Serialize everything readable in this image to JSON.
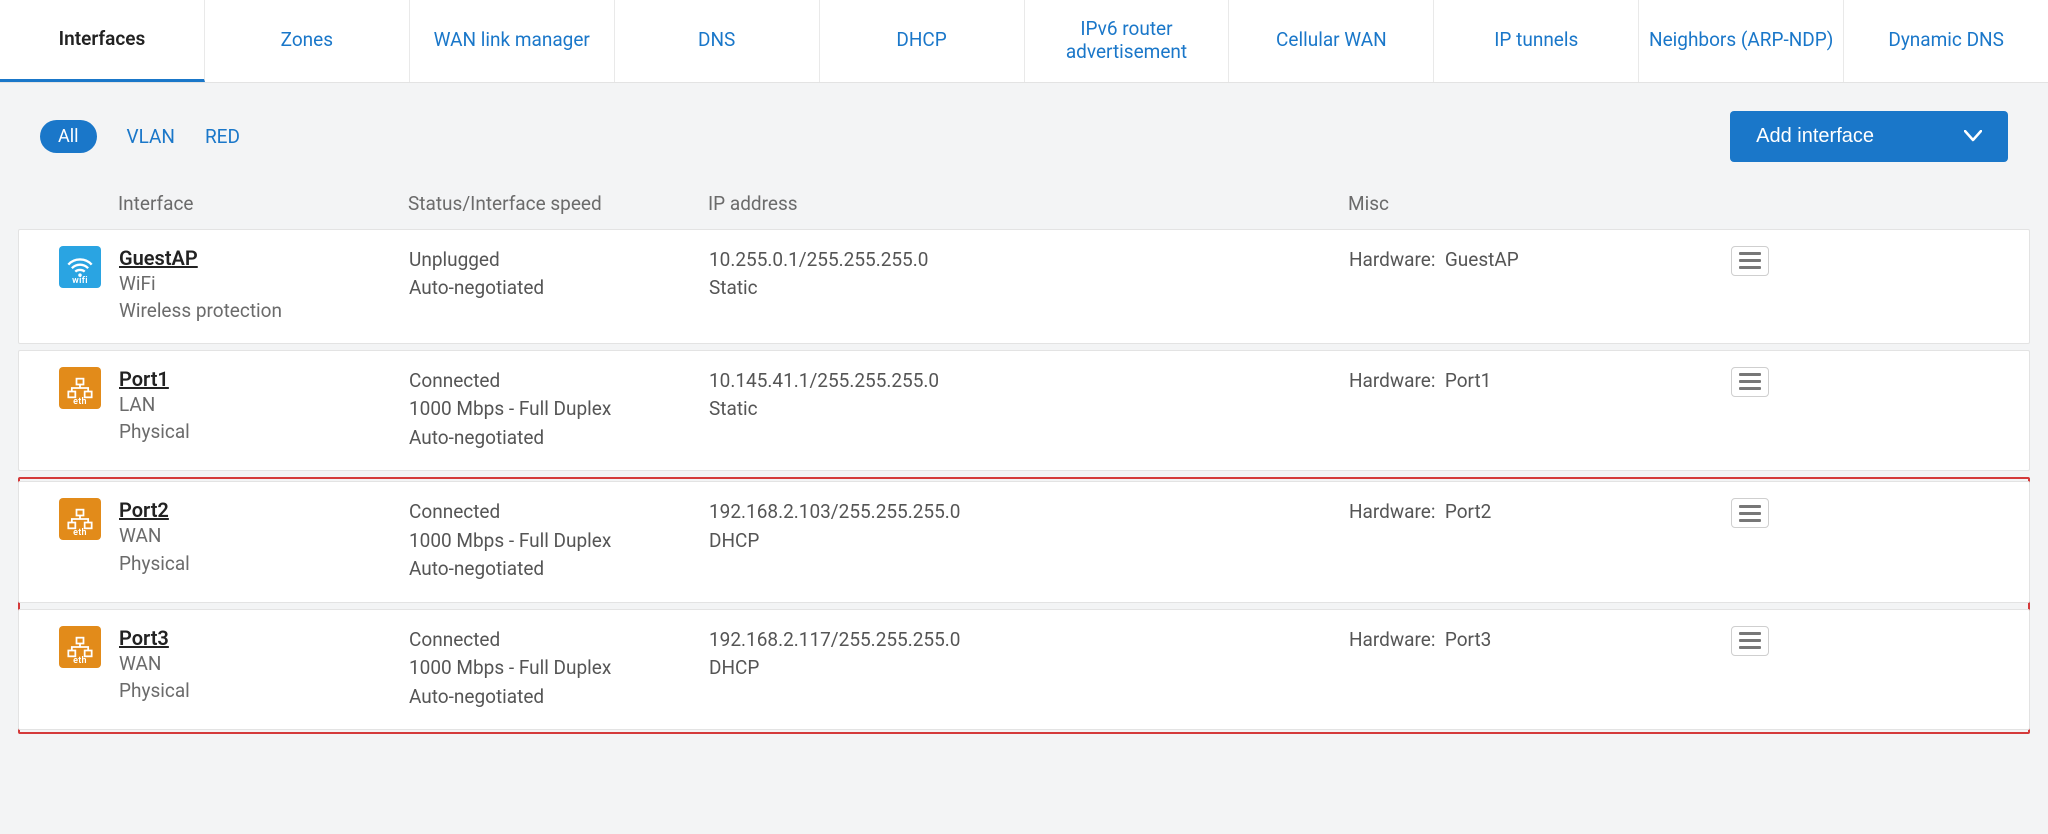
{
  "tabs": [
    {
      "label": "Interfaces",
      "active": true
    },
    {
      "label": "Zones"
    },
    {
      "label": "WAN link manager"
    },
    {
      "label": "DNS"
    },
    {
      "label": "DHCP"
    },
    {
      "label": "IPv6 router advertisement"
    },
    {
      "label": "Cellular WAN"
    },
    {
      "label": "IP tunnels"
    },
    {
      "label": "Neighbors (ARP-NDP)"
    },
    {
      "label": "Dynamic DNS"
    }
  ],
  "filters": {
    "all": "All",
    "vlan": "VLAN",
    "red": "RED"
  },
  "add_button": "Add interface",
  "columns": {
    "interface": "Interface",
    "status": "Status/Interface speed",
    "ip": "IP address",
    "misc": "Misc"
  },
  "rows": [
    {
      "icon": "wifi",
      "name": "GuestAP",
      "sub1": "WiFi",
      "sub2": "Wireless protection",
      "status1": "Unplugged",
      "status2": "Auto-negotiated",
      "status3": "",
      "ip1": "10.255.0.1/255.255.255.0",
      "ip2": "Static",
      "misc_label": "Hardware:",
      "misc_value": "GuestAP"
    },
    {
      "icon": "eth",
      "name": "Port1",
      "sub1": "LAN",
      "sub2": "Physical",
      "status1": "Connected",
      "status2": "1000 Mbps - Full Duplex",
      "status3": "Auto-negotiated",
      "ip1": "10.145.41.1/255.255.255.0",
      "ip2": "Static",
      "misc_label": "Hardware:",
      "misc_value": "Port1"
    },
    {
      "icon": "eth",
      "name": "Port2",
      "sub1": "WAN",
      "sub2": "Physical",
      "status1": "Connected",
      "status2": "1000 Mbps - Full Duplex",
      "status3": "Auto-negotiated",
      "ip1": "192.168.2.103/255.255.255.0",
      "ip2": "DHCP",
      "misc_label": "Hardware:",
      "misc_value": "Port2"
    },
    {
      "icon": "eth",
      "name": "Port3",
      "sub1": "WAN",
      "sub2": "Physical",
      "status1": "Connected",
      "status2": "1000 Mbps - Full Duplex",
      "status3": "Auto-negotiated",
      "ip1": "192.168.2.117/255.255.255.0",
      "ip2": "DHCP",
      "misc_label": "Hardware:",
      "misc_value": "Port3"
    }
  ]
}
